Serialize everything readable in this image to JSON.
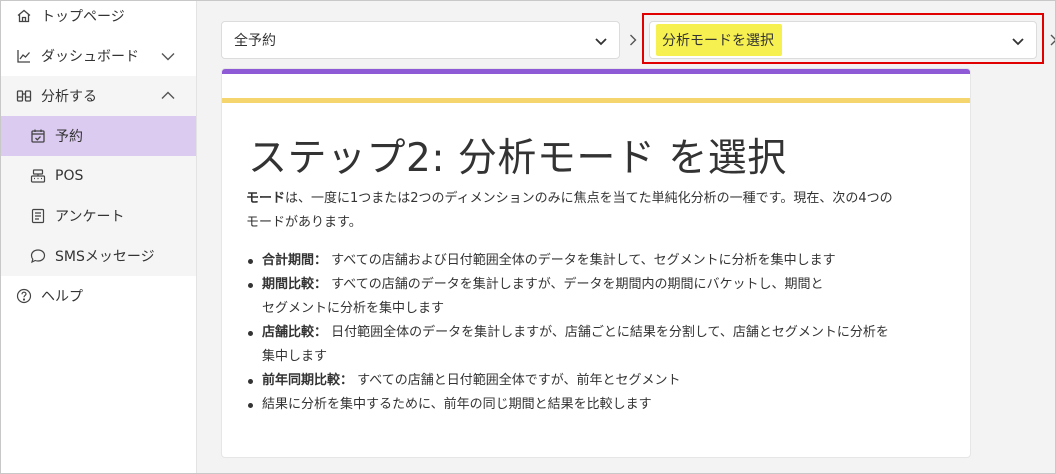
{
  "sidebar": {
    "items": [
      {
        "label": "トップページ",
        "icon": "home-icon"
      },
      {
        "label": "ダッシュボード",
        "icon": "chart-line-icon"
      },
      {
        "label": "分析する",
        "icon": "binoculars-icon"
      },
      {
        "label": "予約",
        "icon": "calendar-check-icon"
      },
      {
        "label": "POS",
        "icon": "register-icon"
      },
      {
        "label": "アンケート",
        "icon": "survey-icon"
      },
      {
        "label": "SMSメッセージ",
        "icon": "chat-bubble-icon"
      },
      {
        "label": "ヘルプ",
        "icon": "help-circle-icon"
      }
    ]
  },
  "toolbar": {
    "data_select": {
      "value": "全予約"
    },
    "mode_select": {
      "value": "分析モードを選択"
    }
  },
  "card": {
    "title": "ステップ2: 分析モード を選択",
    "intro_term": "モード",
    "intro_line1": "は、一度に1つまたは2つのディメンションのみに焦点を当てた単純化分析の一種です。現在、次の4つの",
    "intro_line2": "モードがあります。",
    "modes": [
      {
        "term": "合計期間：",
        "desc": " すべての店舗および日付範囲全体のデータを集計して、セグメントに分析を集中します"
      },
      {
        "term": "期間比較：",
        "desc": " すべての店舗のデータを集計しますが、データを期間内の期間にバケットし、期間と",
        "desc2": "セグメントに分析を集中します"
      },
      {
        "term": "店舗比較：",
        "desc": " 日付範囲全体のデータを集計しますが、店舗ごとに結果を分割して、店舗とセグメントに分析を",
        "desc2": "集中します"
      },
      {
        "term": "前年同期比較：",
        "desc": " すべての店舗と日付範囲全体ですが、前年とセグメント"
      },
      {
        "term": "",
        "desc": "結果に分析を集中するために、前年の同じ期間と結果を比較します"
      }
    ]
  },
  "colors": {
    "active_nav": "#dccbf1",
    "accent_purple": "#8e5ad6",
    "accent_yellow": "#f4d56e",
    "highlight_text": "#f6f051",
    "annotation_red": "#e00000"
  }
}
